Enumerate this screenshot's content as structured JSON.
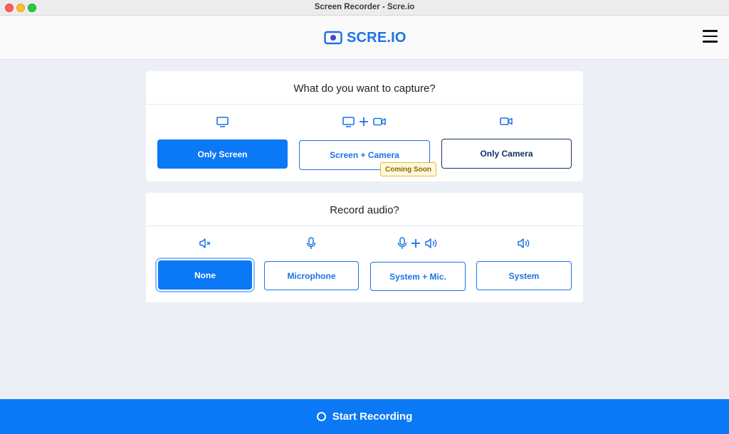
{
  "window": {
    "title": "Screen Recorder - Scre.io"
  },
  "header": {
    "logo_text": "SCRE.IO",
    "logo_icon": "record-screen-icon",
    "menu_icon": "hamburger-menu-icon"
  },
  "capture": {
    "title": "What do you want to capture?",
    "options": [
      {
        "label": "Only Screen",
        "icon": "monitor-icon",
        "state": "selected"
      },
      {
        "label": "Screen + Camera",
        "icon": "monitor-plus-camera-icon",
        "badge": "Coming Soon"
      },
      {
        "label": "Only Camera",
        "icon": "camera-icon"
      }
    ]
  },
  "audio": {
    "title": "Record audio?",
    "options": [
      {
        "label": "None",
        "icon": "speaker-muted-icon",
        "state": "selected"
      },
      {
        "label": "Microphone",
        "icon": "microphone-icon"
      },
      {
        "label": "System + Mic.",
        "icon": "microphone-plus-speaker-icon"
      },
      {
        "label": "System",
        "icon": "speaker-icon"
      }
    ]
  },
  "footer": {
    "start_label": "Start Recording",
    "start_icon": "record-circle-icon"
  },
  "colors": {
    "accent": "#0b78f5",
    "badge_bg": "#fff8df",
    "badge_border": "#e8b92a",
    "background": "#eceff6"
  }
}
